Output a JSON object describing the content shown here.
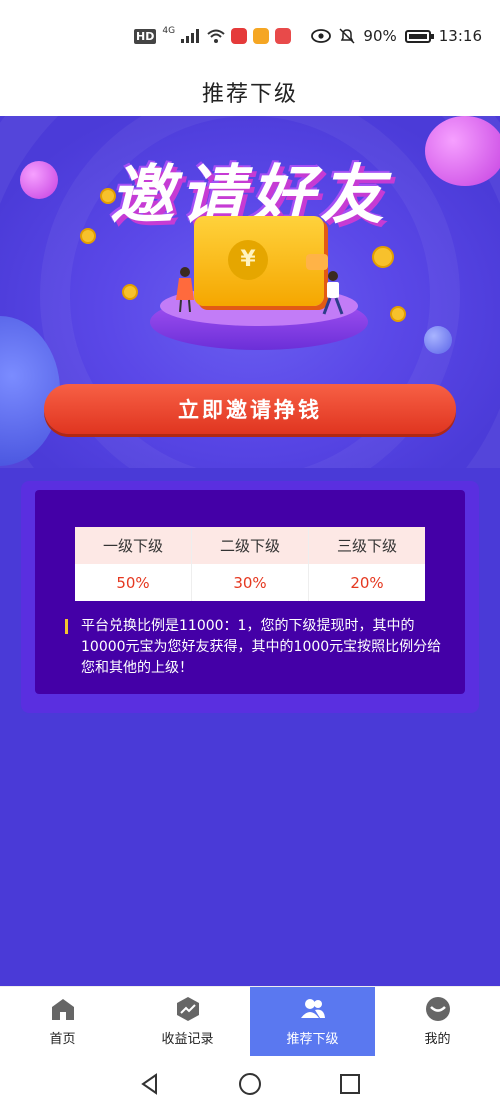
{
  "status_bar": {
    "network_hd": "HD",
    "network_4g": "4G",
    "battery_percent": "90%",
    "time": "13:16"
  },
  "header": {
    "title": "推荐下级"
  },
  "hero": {
    "title": "邀请好友",
    "wallet_symbol": "¥",
    "invite_button_label": "立即邀请挣钱"
  },
  "rates": {
    "columns": [
      {
        "label": "一级下级",
        "value": "50%"
      },
      {
        "label": "二级下级",
        "value": "30%"
      },
      {
        "label": "三级下级",
        "value": "20%"
      }
    ]
  },
  "note": {
    "text": "平台兑换比例是11000：1，您的下级提现时，其中的10000元宝为您好友获得，其中的1000元宝按照比例分给您和其他的上级！"
  },
  "bottom_nav": {
    "items": [
      {
        "label": "首页",
        "icon": "home-icon",
        "active": false
      },
      {
        "label": "收益记录",
        "icon": "trend-icon",
        "active": false
      },
      {
        "label": "推荐下级",
        "icon": "users-icon",
        "active": true
      },
      {
        "label": "我的",
        "icon": "profile-icon",
        "active": false
      }
    ]
  },
  "colors": {
    "background": "#4a3ad7",
    "accent_red": "#e53820",
    "nav_active": "#5a78f0",
    "card_inner": "#4400a7"
  }
}
